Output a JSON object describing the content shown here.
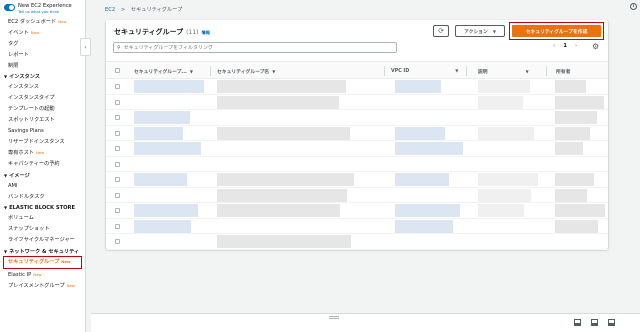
{
  "sidebar": {
    "toggle_label": "New EC2 Experience",
    "toggle_sub": "Tell us what you think",
    "items": [
      {
        "type": "item",
        "label": "EC2 ダッシュボード",
        "badge": "New"
      },
      {
        "type": "item",
        "label": "イベント",
        "badge": "New"
      },
      {
        "type": "item",
        "label": "タグ"
      },
      {
        "type": "item",
        "label": "レポート"
      },
      {
        "type": "item",
        "label": "制限"
      },
      {
        "type": "section",
        "label": "インスタンス"
      },
      {
        "type": "item",
        "label": "インスタンス"
      },
      {
        "type": "item",
        "label": "インスタンスタイプ"
      },
      {
        "type": "item",
        "label": "テンプレートの起動"
      },
      {
        "type": "item",
        "label": "スポットリクエスト"
      },
      {
        "type": "item",
        "label": "Savings Plans"
      },
      {
        "type": "item",
        "label": "リザーブドインスタンス"
      },
      {
        "type": "item",
        "label": "専有ホスト",
        "badge": "New"
      },
      {
        "type": "item",
        "label": "キャパシティーの予約"
      },
      {
        "type": "section",
        "label": "イメージ"
      },
      {
        "type": "item",
        "label": "AMI"
      },
      {
        "type": "item",
        "label": "バンドルタスク"
      },
      {
        "type": "section",
        "label": "ELASTIC BLOCK STORE"
      },
      {
        "type": "item",
        "label": "ボリューム"
      },
      {
        "type": "item",
        "label": "スナップショット"
      },
      {
        "type": "item",
        "label": "ライフサイクルマネージャー"
      },
      {
        "type": "section",
        "label": "ネットワーク & セキュリティ"
      },
      {
        "type": "item",
        "label": "セキュリティグループ",
        "badge": "New",
        "active": true
      },
      {
        "type": "item",
        "label": "Elastic IP",
        "badge": "New"
      },
      {
        "type": "item",
        "label": "プレイスメントグループ",
        "badge": "New"
      }
    ]
  },
  "breadcrumb": {
    "root": "EC2",
    "separator": ">",
    "current": "セキュリティグループ"
  },
  "panel": {
    "title": "セキュリティグループ",
    "count": "(11)",
    "info": "情報",
    "actions_label": "アクション",
    "create_label": "セキュリティグループを作成",
    "search_placeholder": "セキュリティグループをフィルタリング",
    "page_number": "1",
    "columns": [
      "セキュリティグループ...",
      "セキュリティグループ名",
      "VPC ID",
      "説明",
      "所有者"
    ],
    "row_count": 11
  },
  "colors": {
    "accent": "#ec7211",
    "link": "#0073bb",
    "highlight_border": "#c7000b"
  },
  "icons": [
    "refresh-icon",
    "settings-gear-icon",
    "search-icon",
    "info-icon",
    "chevron-left-icon",
    "chevron-right-icon"
  ]
}
